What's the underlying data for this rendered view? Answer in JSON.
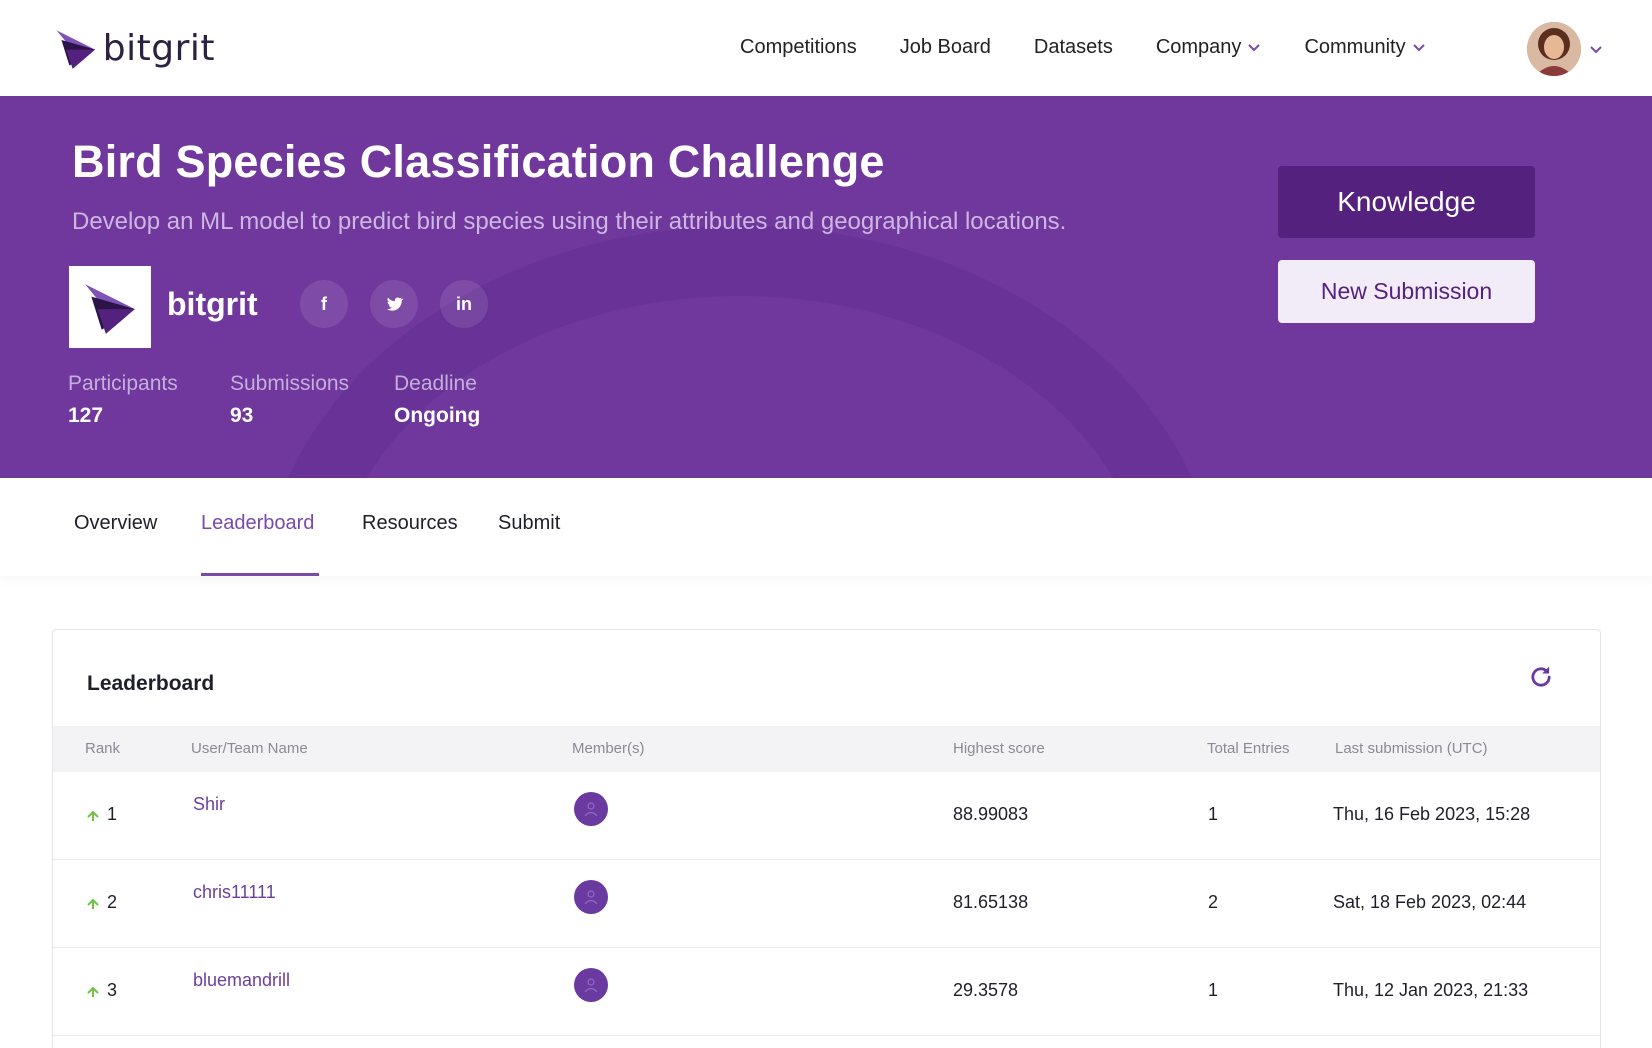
{
  "brand": {
    "name": "bitgrit",
    "accent": "#70389c",
    "accent_dark": "#55217f"
  },
  "nav": {
    "links": [
      {
        "label": "Competitions"
      },
      {
        "label": "Job Board"
      },
      {
        "label": "Datasets"
      },
      {
        "label": "Company",
        "dropdown": true
      },
      {
        "label": "Community",
        "dropdown": true
      }
    ]
  },
  "hero": {
    "title": "Bird Species Classification Challenge",
    "subtitle": "Develop an ML model to predict bird species using their attributes and geographical locations.",
    "org_name": "bitgrit",
    "social": {
      "facebook": "f",
      "twitter": "twitter-icon",
      "linkedin": "in"
    },
    "stats": {
      "participants_label": "Participants",
      "participants": "127",
      "submissions_label": "Submissions",
      "submissions": "93",
      "deadline_label": "Deadline",
      "deadline": "Ongoing"
    },
    "knowledge_label": "Knowledge",
    "new_submission_label": "New Submission"
  },
  "tabs": {
    "overview": "Overview",
    "leaderboard": "Leaderboard",
    "resources": "Resources",
    "submit": "Submit",
    "active": "Leaderboard"
  },
  "leaderboard": {
    "title": "Leaderboard",
    "columns": {
      "rank": "Rank",
      "name": "User/Team Name",
      "members": "Member(s)",
      "score": "Highest score",
      "entries": "Total Entries",
      "last": "Last submission (UTC)"
    },
    "rows": [
      {
        "rank": "1",
        "name": "Shir",
        "score": "88.99083",
        "entries": "1",
        "last": "Thu, 16 Feb 2023, 15:28"
      },
      {
        "rank": "2",
        "name": "chris11111",
        "score": "81.65138",
        "entries": "2",
        "last": "Sat, 18 Feb 2023, 02:44"
      },
      {
        "rank": "3",
        "name": "bluemandrill",
        "score": "29.3578",
        "entries": "1",
        "last": "Thu, 12 Jan 2023, 21:33"
      }
    ]
  }
}
